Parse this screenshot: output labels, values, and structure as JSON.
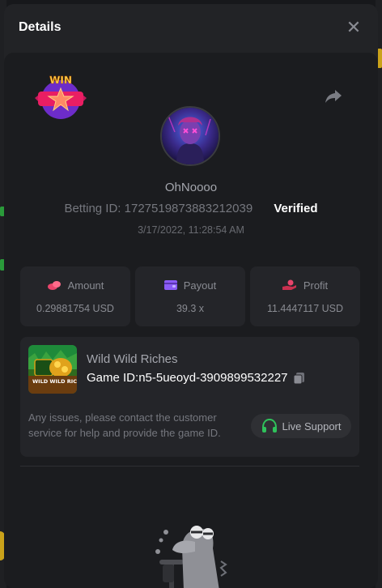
{
  "modal": {
    "title": "Details",
    "close_icon": "close-icon"
  },
  "bet": {
    "username": "OhNoooo",
    "betting_id_label": "Betting ID:",
    "betting_id": "1727519873883212039",
    "verified_label": "Verified",
    "timestamp": "3/17/2022, 11:28:54 AM"
  },
  "stats": [
    {
      "icon": "coins-icon",
      "label": "Amount",
      "value": "0.29881754 USD",
      "color": "#e8456b"
    },
    {
      "icon": "wallet-icon",
      "label": "Payout",
      "value": "39.3 x",
      "color": "#8b5cf6"
    },
    {
      "icon": "hand-coin-icon",
      "label": "Profit",
      "value": "11.4447117 USD",
      "color": "#e8456b"
    }
  ],
  "game": {
    "name": "Wild Wild Riches",
    "thumb_text": "WILD WILD RICHES",
    "id_label": "Game ID:",
    "id_value": "n5-5ueoyd-3909899532227"
  },
  "support": {
    "help_text": "Any issues, please contact the customer service for help and provide the game ID.",
    "live_support_label": "Live Support",
    "accent": "#2fc25b"
  },
  "badge": {
    "text": "WIN"
  },
  "colors": {
    "modal_bg": "#222326",
    "body_bg": "#1b1c1f",
    "card_bg": "#242529"
  }
}
